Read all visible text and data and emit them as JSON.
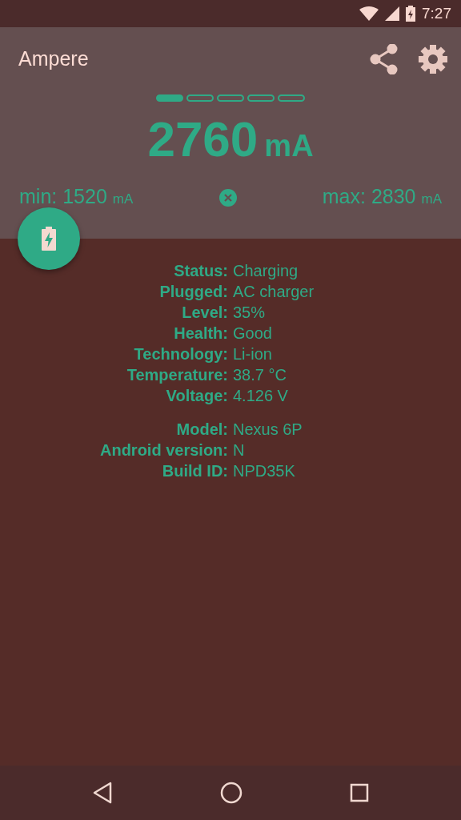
{
  "status_bar": {
    "time": "7:27"
  },
  "app_bar": {
    "title": "Ampere"
  },
  "pager": [
    {
      "selected": true
    },
    {
      "selected": false
    },
    {
      "selected": false
    },
    {
      "selected": false
    },
    {
      "selected": false
    }
  ],
  "current": {
    "value": "2760",
    "unit": "mA"
  },
  "min": {
    "label": "min:",
    "value": "1520",
    "unit": "mA"
  },
  "max": {
    "label": "max:",
    "value": "2830",
    "unit": "mA"
  },
  "info_groups": [
    [
      {
        "label": "Status:",
        "value": "Charging"
      },
      {
        "label": "Plugged:",
        "value": "AC charger"
      },
      {
        "label": "Level:",
        "value": "35%"
      },
      {
        "label": "Health:",
        "value": "Good"
      },
      {
        "label": "Technology:",
        "value": "Li-ion"
      },
      {
        "label": "Temperature:",
        "value": "38.7 °C"
      },
      {
        "label": "Voltage:",
        "value": "4.126 V"
      }
    ],
    [
      {
        "label": "Model:",
        "value": "Nexus 6P"
      },
      {
        "label": "Android version:",
        "value": "N"
      },
      {
        "label": "Build ID:",
        "value": "NPD35K"
      }
    ]
  ]
}
